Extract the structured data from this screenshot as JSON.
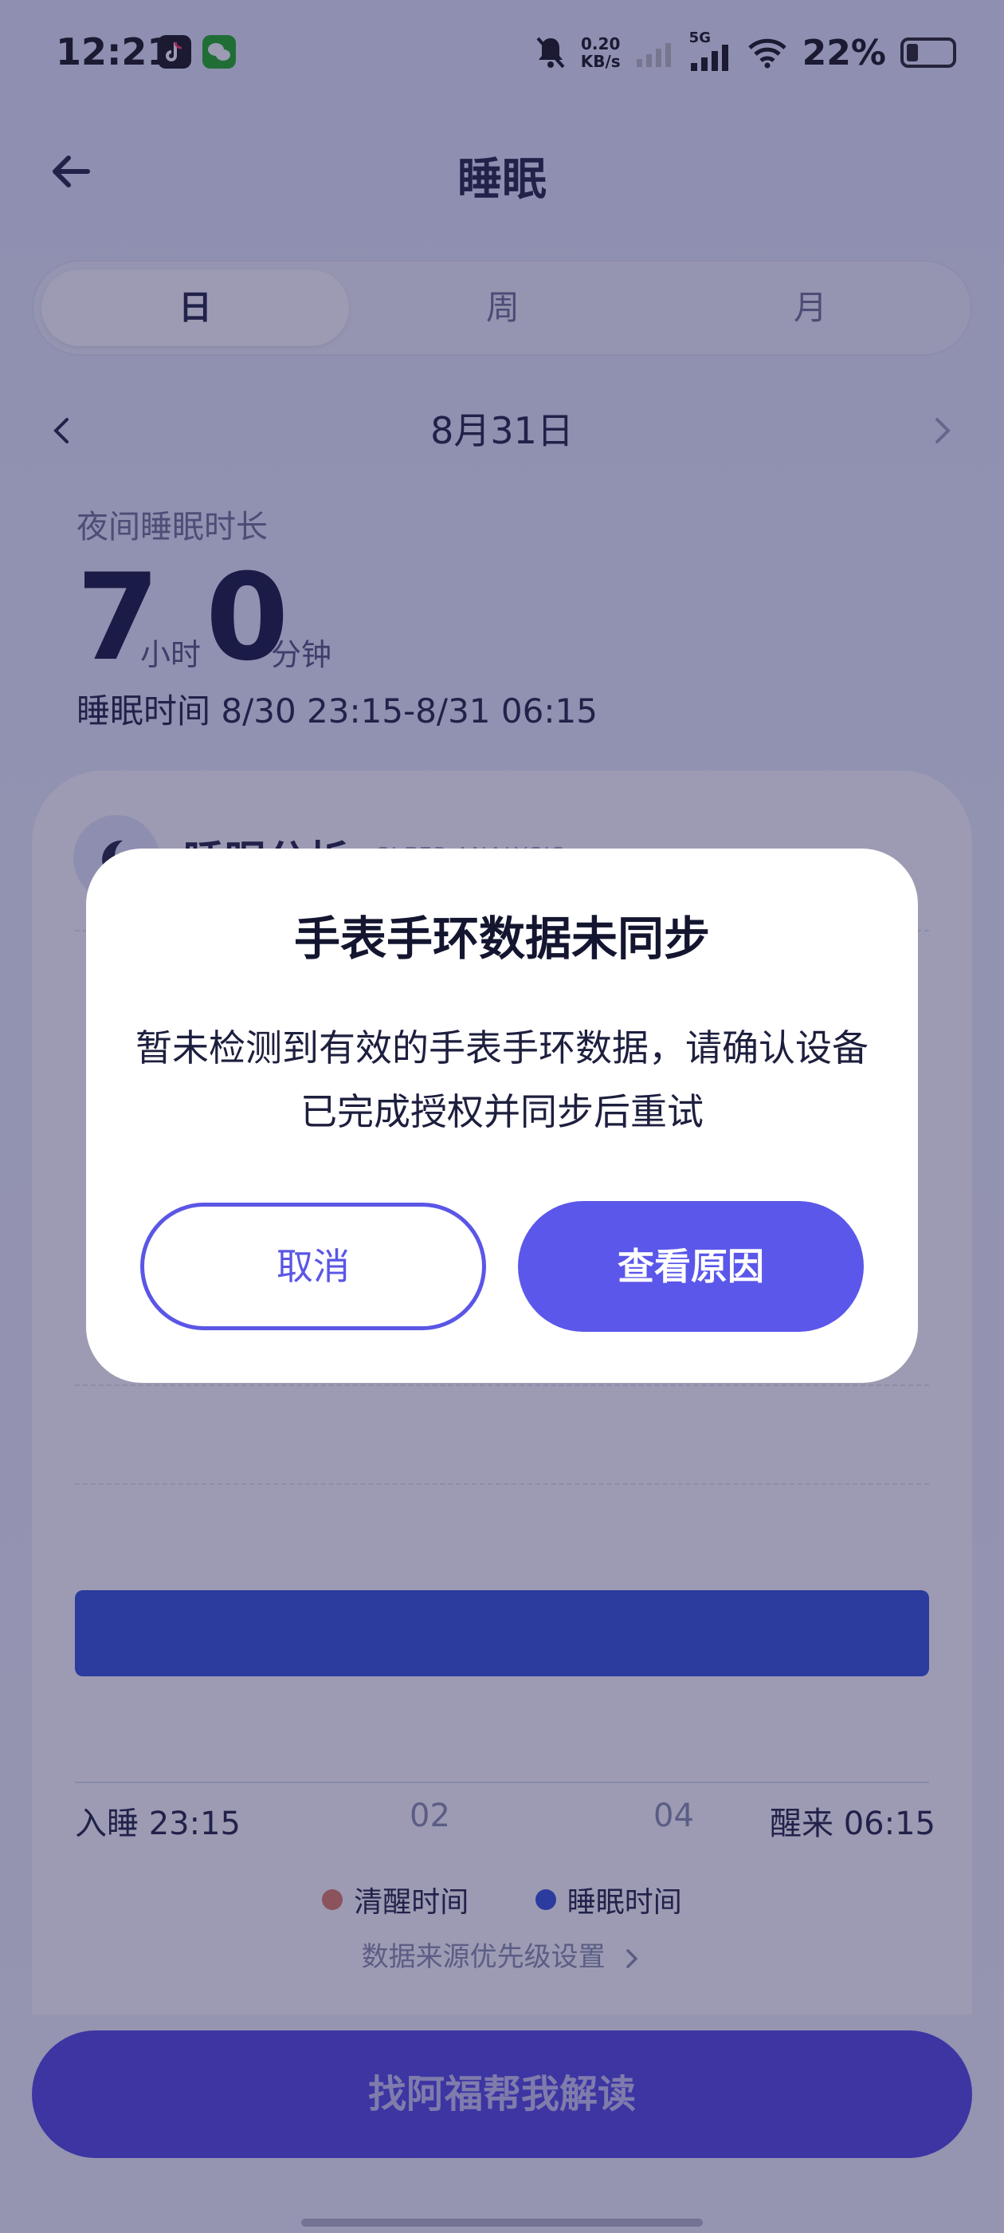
{
  "status_bar": {
    "time": "12:21",
    "net_speed_value": "0.20",
    "net_speed_unit": "KB/s",
    "network_type": "5G",
    "battery": "22%"
  },
  "header": {
    "title": "睡眠"
  },
  "tabs": [
    {
      "label": "日",
      "active": true
    },
    {
      "label": "周",
      "active": false
    },
    {
      "label": "月",
      "active": false
    }
  ],
  "date_nav": {
    "date": "8月31日"
  },
  "summary": {
    "label": "夜间睡眠时长",
    "hours": "7",
    "hours_unit": "小时",
    "minutes": "0",
    "minutes_unit": "分钟",
    "sleep_time": "睡眠时间 8/30 23:15-8/31 06:15"
  },
  "analysis": {
    "title": "睡眠分析",
    "subtitle": "SLEEP ANALYSIS",
    "axis": {
      "start": "入睡 23:15",
      "ticks": [
        "02",
        "04"
      ],
      "end": "醒来 06:15"
    },
    "legend": [
      {
        "label": "清醒时间",
        "color": "#e07a5f"
      },
      {
        "label": "睡眠时间",
        "color": "#2f4ed8"
      }
    ],
    "source_link": "数据来源优先级设置"
  },
  "bottom_button": {
    "label": "找阿福帮我解读"
  },
  "dialog": {
    "title": "手表手环数据未同步",
    "message": "暂未检测到有效的手表手环数据，请确认设备已完成授权并同步后重试",
    "cancel_label": "取消",
    "confirm_label": "查看原因"
  },
  "colors": {
    "accent": "#5b57ea",
    "sleep_bar": "#2f4ed8"
  }
}
